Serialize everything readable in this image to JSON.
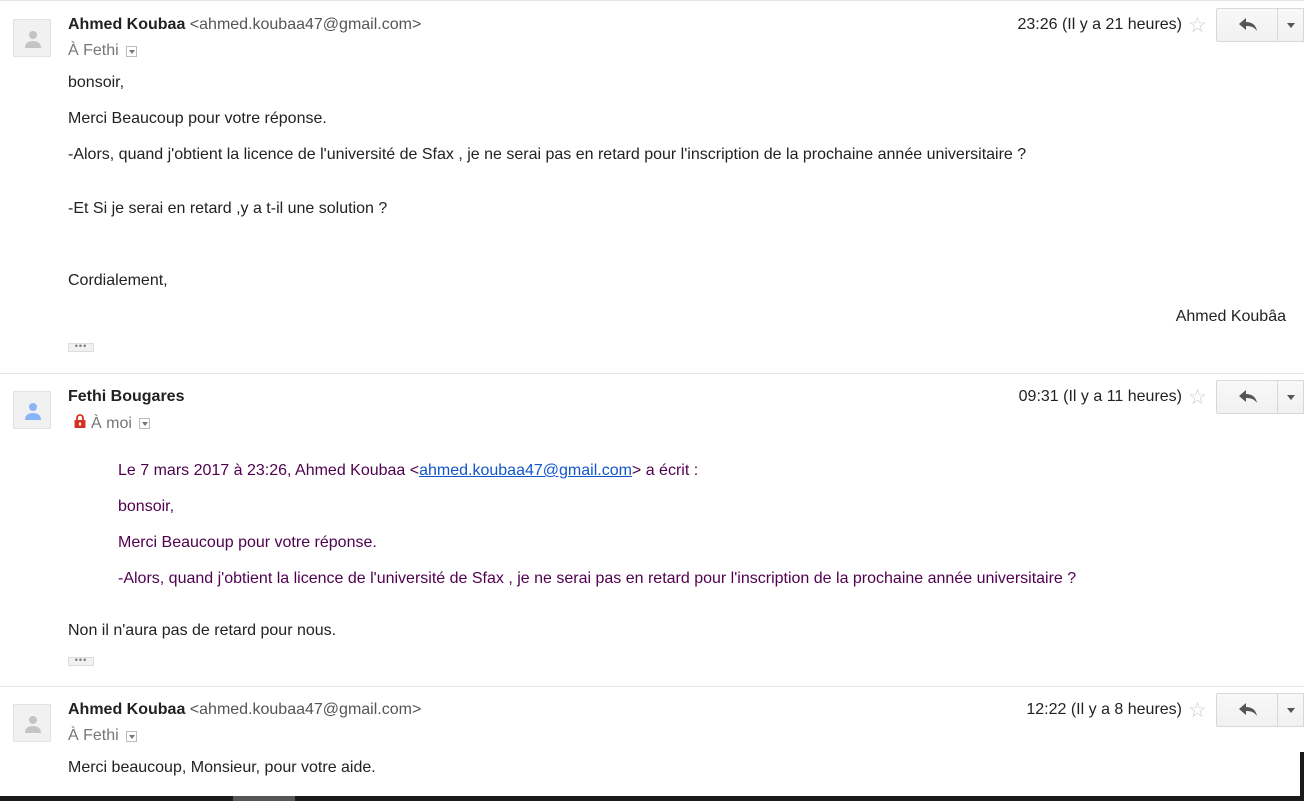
{
  "messages": [
    {
      "sender_name": "Ahmed Koubaa",
      "sender_email": "<ahmed.koubaa47@gmail.com>",
      "recipient": "À Fethi",
      "time": "23:26 (Il y a 21 heures)",
      "body": [
        "bonsoir,",
        "Merci Beaucoup pour votre réponse.",
        "-Alors, quand j'obtient la licence de l'université de Sfax , je ne serai pas en retard pour l'inscription de la prochaine année universitaire ?",
        "-Et Si je serai en retard ,y a t-il une solution ?",
        "Cordialement,"
      ],
      "signature": "Ahmed Koubâa"
    },
    {
      "sender_name": "Fethi Bougares",
      "recipient": "À moi",
      "time": "09:31 (Il y a 11 heures)",
      "quote_header_pre": "Le 7 mars 2017 à 23:26, Ahmed Koubaa <",
      "quote_header_link": "ahmed.koubaa47@gmail.com",
      "quote_header_post": "> a écrit :",
      "quote": [
        "bonsoir,",
        "Merci Beaucoup pour votre réponse.",
        "-Alors, quand j'obtient la licence de l'université de Sfax , je ne serai pas en retard pour l'inscription de la prochaine année universitaire ?"
      ],
      "body": [
        "Non il n'aura pas de retard pour nous."
      ]
    },
    {
      "sender_name": "Ahmed Koubaa",
      "sender_email": "<ahmed.koubaa47@gmail.com>",
      "recipient": "À Fethi",
      "time": "12:22 (Il y a 8 heures)",
      "body": [
        "Merci beaucoup, Monsieur, pour votre aide."
      ]
    }
  ],
  "ui": {
    "ellipsis": "•••",
    "star_glyph": "☆",
    "colors": {
      "quote_text": "#500050",
      "link": "#1155cc",
      "lock_icon": "#d93025"
    }
  }
}
